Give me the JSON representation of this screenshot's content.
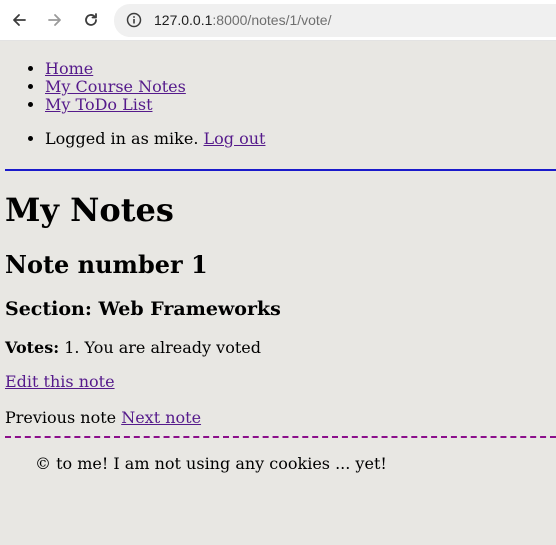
{
  "browser": {
    "url_host": "127.0.0.1",
    "url_rest": ":8000/notes/1/vote/",
    "icons": {
      "back": "arrow-left-icon",
      "forward": "arrow-right-icon",
      "reload": "reload-icon",
      "site_info": "info-icon"
    }
  },
  "nav": {
    "items": [
      {
        "label": "Home"
      },
      {
        "label": "My Course Notes"
      },
      {
        "label": "My ToDo List"
      }
    ]
  },
  "auth": {
    "text": "Logged in as mike. ",
    "logout_label": "Log out"
  },
  "main": {
    "page_title": "My Notes",
    "note_title": "Note number 1",
    "section_label": "Section: Web Frameworks",
    "votes_label": "Votes:",
    "votes_text": " 1. You are already voted",
    "edit_label": "Edit this note",
    "previous_label": "Previous note",
    "next_label": "Next note"
  },
  "footer": {
    "text": "© to me! I am not using any cookies ... yet!"
  },
  "colors": {
    "page_background": "#e8e7e3",
    "link": "#551a8b",
    "header_rule": "#1a1acb",
    "footer_rule": "#8b0f8b"
  }
}
